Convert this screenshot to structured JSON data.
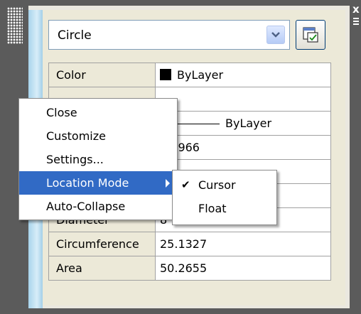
{
  "palette": {
    "selector_value": "Circle",
    "title_close": "x"
  },
  "properties": [
    {
      "name": "Color",
      "value": "ByLayer"
    },
    {
      "name": "",
      "value": ""
    },
    {
      "name": "",
      "value": "ByLayer"
    },
    {
      "name": "",
      "value": "5.0966"
    },
    {
      "name": "",
      "value": ""
    },
    {
      "name": "",
      "value": ""
    },
    {
      "name": "Diameter",
      "value": "8"
    },
    {
      "name": "Circumference",
      "value": "25.1327"
    },
    {
      "name": "Area",
      "value": "50.2655"
    }
  ],
  "context_menu": {
    "items": [
      "Close",
      "Customize",
      "Settings...",
      "Location Mode",
      "Auto-Collapse"
    ]
  },
  "submenu": {
    "items": [
      "Cursor",
      "Float"
    ],
    "checked": "Cursor"
  },
  "colors": {
    "highlight": "#316ac5",
    "panel_bg": "#ece9d8",
    "strip": "#a8d4ec"
  }
}
